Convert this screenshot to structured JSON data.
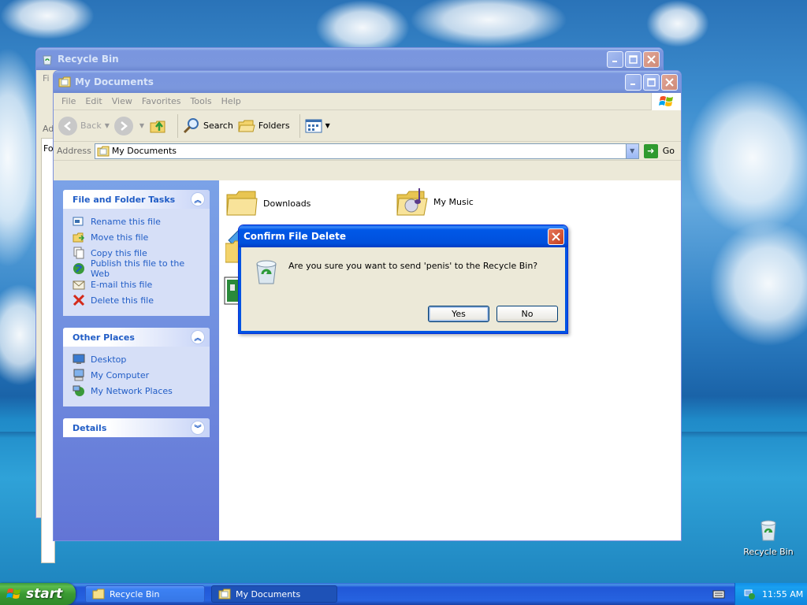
{
  "desktop": {
    "icons": [
      {
        "label": "Recycle Bin",
        "icon": "recycle-bin-icon"
      }
    ]
  },
  "recycle_window": {
    "title": "Recycle Bin",
    "partial_menu": "Fi",
    "partial_address": "Ad",
    "partial_folders": "Fo"
  },
  "docs_window": {
    "title": "My Documents",
    "menu": [
      "File",
      "Edit",
      "View",
      "Favorites",
      "Tools",
      "Help"
    ],
    "toolbar": {
      "back": "Back",
      "search": "Search",
      "folders": "Folders"
    },
    "address": {
      "label": "Address",
      "value": "My Documents",
      "go": "Go"
    },
    "task_panels": {
      "file_tasks": {
        "title": "File and Folder Tasks",
        "items": [
          {
            "label": "Rename this file",
            "icon": "rename-icon"
          },
          {
            "label": "Move this file",
            "icon": "move-icon"
          },
          {
            "label": "Copy this file",
            "icon": "copy-icon"
          },
          {
            "label": "Publish this file to the Web",
            "icon": "globe-icon"
          },
          {
            "label": "E-mail this file",
            "icon": "email-icon"
          },
          {
            "label": "Delete this file",
            "icon": "delete-icon"
          }
        ]
      },
      "other_places": {
        "title": "Other Places",
        "items": [
          {
            "label": "Desktop",
            "icon": "desktop-icon"
          },
          {
            "label": "My Computer",
            "icon": "computer-icon"
          },
          {
            "label": "My Network Places",
            "icon": "network-icon"
          }
        ]
      },
      "details": {
        "title": "Details"
      }
    },
    "files": [
      {
        "label": "Downloads",
        "icon": "folder-icon"
      },
      {
        "label": "My Music",
        "icon": "music-folder-icon"
      }
    ]
  },
  "dialog": {
    "title": "Confirm File Delete",
    "message": "Are you sure you want to send 'penis' to the Recycle Bin?",
    "yes": "Yes",
    "no": "No"
  },
  "taskbar": {
    "start": "start",
    "tasks": [
      "Recycle Bin",
      "My Documents"
    ],
    "clock": "11:55 AM"
  },
  "colors": {
    "title_active": "#0054e3",
    "task_link": "#215dc6",
    "start_green": "#3a9a32"
  }
}
